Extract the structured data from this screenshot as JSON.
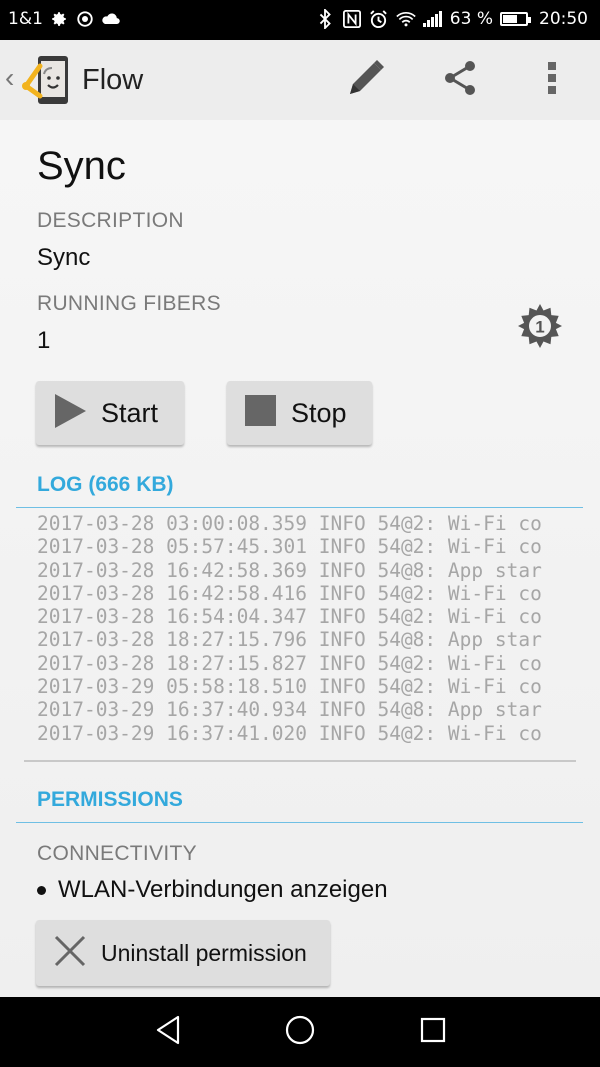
{
  "status_bar": {
    "carrier": "1&1",
    "battery_percent": "63 %",
    "battery_level": 0.63,
    "time": "20:50",
    "left_icons": [
      "gear-icon",
      "whatsapp-icon",
      "cloud-icon"
    ],
    "right_icons": [
      "bluetooth-icon",
      "nfc-icon",
      "alarm-icon",
      "wifi-icon",
      "signal-icon",
      "battery-icon"
    ]
  },
  "action_bar": {
    "title": "Flow",
    "actions": [
      "edit-icon",
      "share-icon",
      "overflow-menu-icon"
    ]
  },
  "flow": {
    "name": "Sync",
    "description_label": "DESCRIPTION",
    "description_value": "Sync",
    "fibers_label": "RUNNING FIBERS",
    "fibers_value": "1",
    "fibers_badge": "1"
  },
  "buttons": {
    "start": "Start",
    "stop": "Stop",
    "uninstall": "Uninstall permission"
  },
  "log": {
    "title": "LOG (666 KB)",
    "lines": [
      "2017-03-28 03:00:08.359 INFO 54@2: Wi-Fi co",
      "2017-03-28 05:57:45.301 INFO 54@2: Wi-Fi co",
      "2017-03-28 16:42:58.369 INFO 54@8: App star",
      "2017-03-28 16:42:58.416 INFO 54@2: Wi-Fi co",
      "2017-03-28 16:54:04.347 INFO 54@2: Wi-Fi co",
      "2017-03-28 18:27:15.796 INFO 54@8: App star",
      "2017-03-28 18:27:15.827 INFO 54@2: Wi-Fi co",
      "2017-03-29 05:58:18.510 INFO 54@2: Wi-Fi co",
      "2017-03-29 16:37:40.934 INFO 54@8: App star",
      "2017-03-29 16:37:41.020 INFO 54@2: Wi-Fi co"
    ]
  },
  "permissions": {
    "title": "PERMISSIONS",
    "category": "CONNECTIVITY",
    "item": "WLAN-Verbindungen anzeigen"
  },
  "colors": {
    "accent": "#33a9dc",
    "logo_yellow": "#f2b31e",
    "statusbar": "#000000",
    "actionbar": "#ededed"
  }
}
